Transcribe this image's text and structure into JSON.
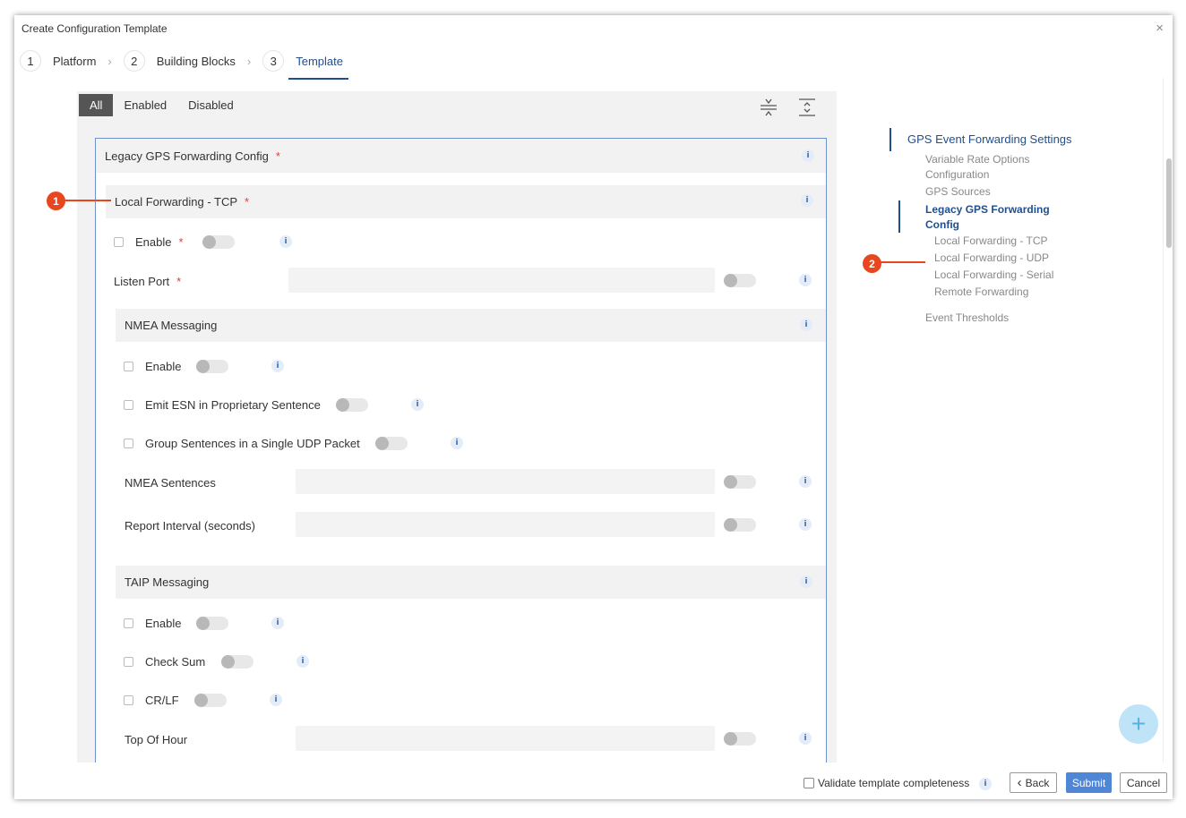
{
  "dialog": {
    "title": "Create Configuration Template",
    "close": "×"
  },
  "steps": [
    {
      "num": "1",
      "label": "Platform"
    },
    {
      "num": "2",
      "label": "Building Blocks"
    },
    {
      "num": "3",
      "label": "Template"
    }
  ],
  "filter": {
    "all": "All",
    "enabled": "Enabled",
    "disabled": "Disabled"
  },
  "form": {
    "section_title": "Legacy GPS Forwarding Config",
    "subsection_title": "Local Forwarding - TCP",
    "required_mark": "*",
    "info_glyph": "i",
    "enable": "Enable",
    "listen_port": "Listen Port",
    "nmea": {
      "title": "NMEA Messaging",
      "enable": "Enable",
      "emit_esn": "Emit ESN in Proprietary Sentence",
      "group_sentences": "Group Sentences in a Single UDP Packet",
      "sentences": "NMEA Sentences",
      "report_interval": "Report Interval (seconds)"
    },
    "taip": {
      "title": "TAIP Messaging",
      "enable": "Enable",
      "check_sum": "Check Sum",
      "crlf": "CR/LF",
      "top_of_hour": "Top Of Hour"
    }
  },
  "nav": {
    "top": "GPS Event Forwarding Settings",
    "items": [
      "Variable Rate Options",
      "Configuration",
      "GPS Sources"
    ],
    "active_line1": "Legacy GPS Forwarding",
    "active_line2": "Config",
    "subitems": [
      "Local Forwarding - TCP",
      "Local Forwarding - UDP",
      "Local Forwarding - Serial",
      "Remote Forwarding"
    ],
    "last": "Event Thresholds"
  },
  "callouts": [
    "1",
    "2"
  ],
  "fab": "+",
  "footer": {
    "validate": "Validate template completeness",
    "back": "Back",
    "back_icon": "‹",
    "submit": "Submit",
    "cancel": "Cancel"
  },
  "colors": {
    "accent": "#1f4f8f",
    "required": "#e03c3c",
    "callout": "#e8461e",
    "primary_button": "#4f86d6"
  }
}
